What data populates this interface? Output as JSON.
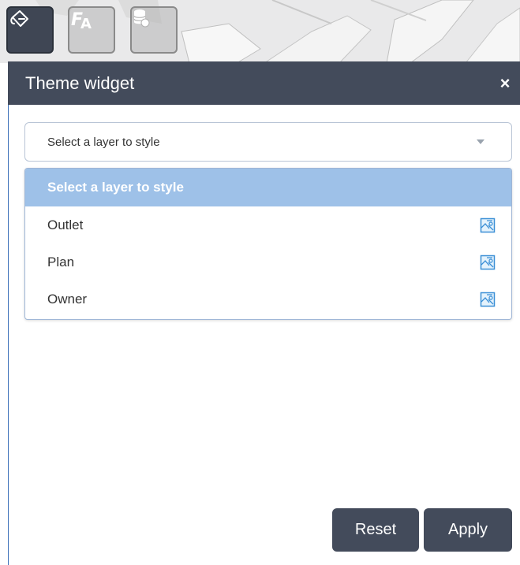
{
  "toolbar": {
    "buttons": [
      {
        "icon": "paint-bucket-icon",
        "active": true
      },
      {
        "icon": "font-style-icon",
        "active": false
      },
      {
        "icon": "database-icon",
        "active": false
      }
    ]
  },
  "widget": {
    "title": "Theme widget",
    "close_label": "×"
  },
  "layer_select": {
    "value": "Select a layer to style",
    "options_header": "Select a layer to style",
    "options": [
      {
        "label": "Outlet",
        "icon": "style-layer-icon"
      },
      {
        "label": "Plan",
        "icon": "style-layer-icon"
      },
      {
        "label": "Owner",
        "icon": "style-layer-icon"
      }
    ]
  },
  "actions": {
    "reset_label": "Reset",
    "apply_label": "Apply"
  },
  "colors": {
    "header_bg": "#434b5b",
    "option_highlight": "#9ec1e8",
    "icon_accent": "#3a8fd6"
  }
}
